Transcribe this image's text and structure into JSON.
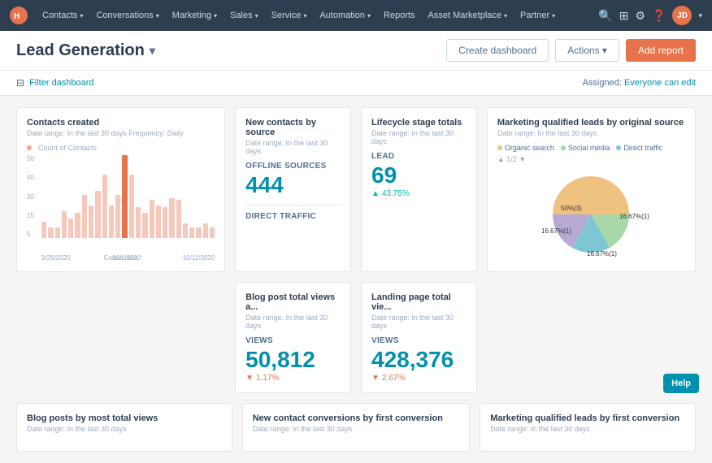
{
  "nav": {
    "items": [
      {
        "label": "Contacts",
        "has_dropdown": true
      },
      {
        "label": "Conversations",
        "has_dropdown": true
      },
      {
        "label": "Marketing",
        "has_dropdown": true
      },
      {
        "label": "Sales",
        "has_dropdown": true
      },
      {
        "label": "Service",
        "has_dropdown": true
      },
      {
        "label": "Automation",
        "has_dropdown": true
      },
      {
        "label": "Reports",
        "has_dropdown": false
      },
      {
        "label": "Asset Marketplace",
        "has_dropdown": true
      },
      {
        "label": "Partner",
        "has_dropdown": true
      }
    ],
    "avatar_initials": "JD"
  },
  "page": {
    "title": "Lead Generation",
    "dropdown_arrow": "▾",
    "create_dashboard_label": "Create dashboard",
    "actions_label": "Actions ▾",
    "add_report_label": "Add report"
  },
  "filter_bar": {
    "filter_label": "Filter dashboard",
    "assigned_label": "Assigned:",
    "edit_link": "Everyone can edit"
  },
  "cards": {
    "contacts_created": {
      "title": "Contacts created",
      "subtitle": "Date range: In the last 30 days   Frequency: Daily",
      "legend": "Count of Contacts",
      "legend_color": "#f5a58a",
      "bars": [
        9,
        6,
        6,
        15,
        11,
        14,
        24,
        18,
        26,
        35,
        18,
        24,
        46,
        35,
        17,
        14,
        21,
        18,
        17,
        22,
        21,
        8,
        6,
        6,
        8,
        6
      ],
      "y_labels": [
        "50",
        "40",
        "30",
        "15",
        "5"
      ],
      "x_labels": [
        "9/26/2020",
        "10/1/2020",
        "10/11/2020"
      ],
      "x_label_main": "Create date"
    },
    "new_contacts_source": {
      "title": "New contacts by source",
      "subtitle": "Date range: In the last 30 days",
      "offline_label": "OFFLINE SOURCES",
      "offline_value": "444",
      "direct_label": "DIRECT TRAFFIC"
    },
    "lifecycle_stage": {
      "title": "Lifecycle stage totals",
      "subtitle": "Date range: In the last 30 days",
      "lead_label": "LEAD",
      "lead_value": "69",
      "lead_change": "43.75%",
      "lead_change_dir": "up"
    },
    "mql_source": {
      "title": "Marketing qualified leads by original source",
      "subtitle": "Date range: In the last 30 days",
      "legend_items": [
        {
          "label": "Organic search",
          "color": "#f0c27f"
        },
        {
          "label": "Social media",
          "color": "#a8d8a8"
        },
        {
          "label": "Direct traffic",
          "color": "#7dc7d4"
        }
      ],
      "pie_segments": [
        {
          "label": "50% (3)",
          "pct": 50,
          "color": "#f0c27f",
          "pos": "left"
        },
        {
          "label": "16.67% (1)",
          "pct": 16.67,
          "color": "#a8d8a8",
          "pos": "top"
        },
        {
          "label": "16.67% (1)",
          "pct": 16.67,
          "color": "#7dc7d4",
          "pos": "right"
        },
        {
          "label": "16.67% (1)",
          "pct": 16.67,
          "color": "#b8a8d4",
          "pos": "bottom"
        }
      ]
    },
    "blog_views": {
      "title": "Blog post total views a...",
      "subtitle": "Date range: In the last 30 days",
      "views_label": "VIEWS",
      "views_value": "50,812",
      "change": "1.17%",
      "change_dir": "down"
    },
    "landing_page_views": {
      "title": "Landing page total vie...",
      "subtitle": "Date range: In the last 30 days",
      "views_label": "VIEWS",
      "views_value": "428,376",
      "change": "2.67%",
      "change_dir": "down"
    },
    "blog_posts_most": {
      "title": "Blog posts by most total views",
      "subtitle": "Date range: In the last 30 days"
    },
    "new_contact_conversions": {
      "title": "New contact conversions by first conversion",
      "subtitle": "Date range: In the last 30 days"
    },
    "mql_conversion": {
      "title": "Marketing qualified leads by first conversion",
      "subtitle": "Date range: In the last 30 days"
    }
  },
  "help": {
    "label": "Help"
  }
}
